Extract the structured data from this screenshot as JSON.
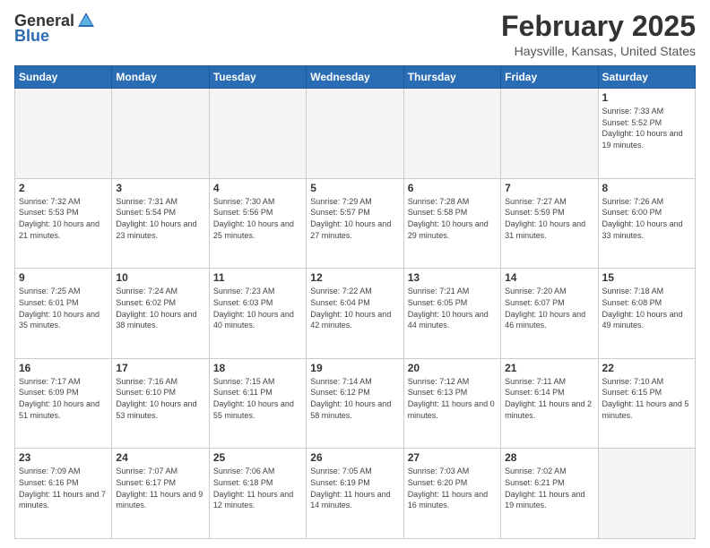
{
  "header": {
    "logo_general": "General",
    "logo_blue": "Blue",
    "month_title": "February 2025",
    "location": "Haysville, Kansas, United States"
  },
  "days_of_week": [
    "Sunday",
    "Monday",
    "Tuesday",
    "Wednesday",
    "Thursday",
    "Friday",
    "Saturday"
  ],
  "weeks": [
    [
      {
        "day": "",
        "empty": true
      },
      {
        "day": "",
        "empty": true
      },
      {
        "day": "",
        "empty": true
      },
      {
        "day": "",
        "empty": true
      },
      {
        "day": "",
        "empty": true
      },
      {
        "day": "",
        "empty": true
      },
      {
        "day": "1",
        "sunrise": "7:33 AM",
        "sunset": "5:52 PM",
        "daylight": "10 hours and 19 minutes."
      }
    ],
    [
      {
        "day": "2",
        "sunrise": "7:32 AM",
        "sunset": "5:53 PM",
        "daylight": "10 hours and 21 minutes."
      },
      {
        "day": "3",
        "sunrise": "7:31 AM",
        "sunset": "5:54 PM",
        "daylight": "10 hours and 23 minutes."
      },
      {
        "day": "4",
        "sunrise": "7:30 AM",
        "sunset": "5:56 PM",
        "daylight": "10 hours and 25 minutes."
      },
      {
        "day": "5",
        "sunrise": "7:29 AM",
        "sunset": "5:57 PM",
        "daylight": "10 hours and 27 minutes."
      },
      {
        "day": "6",
        "sunrise": "7:28 AM",
        "sunset": "5:58 PM",
        "daylight": "10 hours and 29 minutes."
      },
      {
        "day": "7",
        "sunrise": "7:27 AM",
        "sunset": "5:59 PM",
        "daylight": "10 hours and 31 minutes."
      },
      {
        "day": "8",
        "sunrise": "7:26 AM",
        "sunset": "6:00 PM",
        "daylight": "10 hours and 33 minutes."
      }
    ],
    [
      {
        "day": "9",
        "sunrise": "7:25 AM",
        "sunset": "6:01 PM",
        "daylight": "10 hours and 35 minutes."
      },
      {
        "day": "10",
        "sunrise": "7:24 AM",
        "sunset": "6:02 PM",
        "daylight": "10 hours and 38 minutes."
      },
      {
        "day": "11",
        "sunrise": "7:23 AM",
        "sunset": "6:03 PM",
        "daylight": "10 hours and 40 minutes."
      },
      {
        "day": "12",
        "sunrise": "7:22 AM",
        "sunset": "6:04 PM",
        "daylight": "10 hours and 42 minutes."
      },
      {
        "day": "13",
        "sunrise": "7:21 AM",
        "sunset": "6:05 PM",
        "daylight": "10 hours and 44 minutes."
      },
      {
        "day": "14",
        "sunrise": "7:20 AM",
        "sunset": "6:07 PM",
        "daylight": "10 hours and 46 minutes."
      },
      {
        "day": "15",
        "sunrise": "7:18 AM",
        "sunset": "6:08 PM",
        "daylight": "10 hours and 49 minutes."
      }
    ],
    [
      {
        "day": "16",
        "sunrise": "7:17 AM",
        "sunset": "6:09 PM",
        "daylight": "10 hours and 51 minutes."
      },
      {
        "day": "17",
        "sunrise": "7:16 AM",
        "sunset": "6:10 PM",
        "daylight": "10 hours and 53 minutes."
      },
      {
        "day": "18",
        "sunrise": "7:15 AM",
        "sunset": "6:11 PM",
        "daylight": "10 hours and 55 minutes."
      },
      {
        "day": "19",
        "sunrise": "7:14 AM",
        "sunset": "6:12 PM",
        "daylight": "10 hours and 58 minutes."
      },
      {
        "day": "20",
        "sunrise": "7:12 AM",
        "sunset": "6:13 PM",
        "daylight": "11 hours and 0 minutes."
      },
      {
        "day": "21",
        "sunrise": "7:11 AM",
        "sunset": "6:14 PM",
        "daylight": "11 hours and 2 minutes."
      },
      {
        "day": "22",
        "sunrise": "7:10 AM",
        "sunset": "6:15 PM",
        "daylight": "11 hours and 5 minutes."
      }
    ],
    [
      {
        "day": "23",
        "sunrise": "7:09 AM",
        "sunset": "6:16 PM",
        "daylight": "11 hours and 7 minutes."
      },
      {
        "day": "24",
        "sunrise": "7:07 AM",
        "sunset": "6:17 PM",
        "daylight": "11 hours and 9 minutes."
      },
      {
        "day": "25",
        "sunrise": "7:06 AM",
        "sunset": "6:18 PM",
        "daylight": "11 hours and 12 minutes."
      },
      {
        "day": "26",
        "sunrise": "7:05 AM",
        "sunset": "6:19 PM",
        "daylight": "11 hours and 14 minutes."
      },
      {
        "day": "27",
        "sunrise": "7:03 AM",
        "sunset": "6:20 PM",
        "daylight": "11 hours and 16 minutes."
      },
      {
        "day": "28",
        "sunrise": "7:02 AM",
        "sunset": "6:21 PM",
        "daylight": "11 hours and 19 minutes."
      },
      {
        "day": "",
        "empty": true
      }
    ]
  ]
}
